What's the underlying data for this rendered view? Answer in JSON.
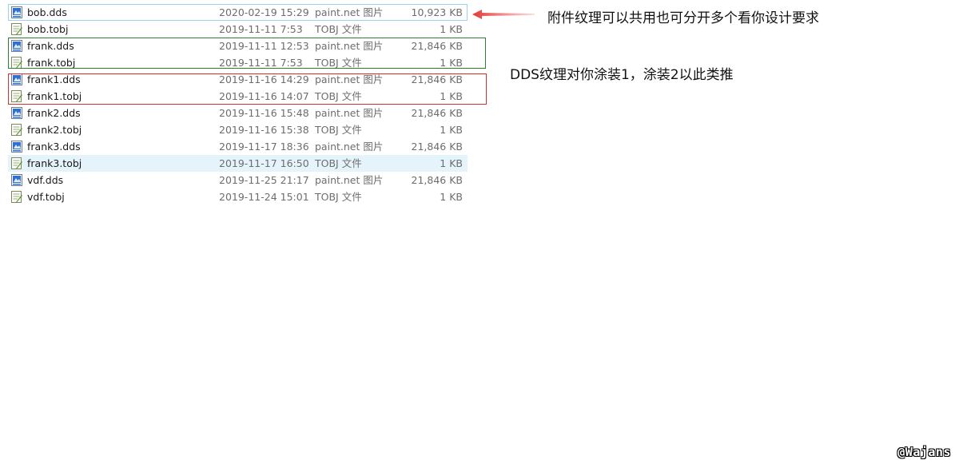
{
  "files": [
    {
      "name": "bob.dds",
      "date": "2020-02-19 15:29",
      "type": "paint.net 图片",
      "size": "10,923 KB",
      "icon": "dds-image-icon"
    },
    {
      "name": "bob.tobj",
      "date": "2019-11-11 7:53",
      "type": "TOBJ 文件",
      "size": "1 KB",
      "icon": "tobj-file-icon"
    },
    {
      "name": "frank.dds",
      "date": "2019-11-11 12:53",
      "type": "paint.net 图片",
      "size": "21,846 KB",
      "icon": "dds-image-icon"
    },
    {
      "name": "frank.tobj",
      "date": "2019-11-11 7:53",
      "type": "TOBJ 文件",
      "size": "1 KB",
      "icon": "tobj-file-icon"
    },
    {
      "name": "frank1.dds",
      "date": "2019-11-16 14:29",
      "type": "paint.net 图片",
      "size": "21,846 KB",
      "icon": "dds-image-icon"
    },
    {
      "name": "frank1.tobj",
      "date": "2019-11-16 14:07",
      "type": "TOBJ 文件",
      "size": "1 KB",
      "icon": "tobj-file-icon"
    },
    {
      "name": "frank2.dds",
      "date": "2019-11-16 15:48",
      "type": "paint.net 图片",
      "size": "21,846 KB",
      "icon": "dds-image-icon"
    },
    {
      "name": "frank2.tobj",
      "date": "2019-11-16 15:38",
      "type": "TOBJ 文件",
      "size": "1 KB",
      "icon": "tobj-file-icon"
    },
    {
      "name": "frank3.dds",
      "date": "2019-11-17 18:36",
      "type": "paint.net 图片",
      "size": "21,846 KB",
      "icon": "dds-image-icon"
    },
    {
      "name": "frank3.tobj",
      "date": "2019-11-17 16:50",
      "type": "TOBJ 文件",
      "size": "1 KB",
      "icon": "tobj-file-icon"
    },
    {
      "name": "vdf.dds",
      "date": "2019-11-25 21:17",
      "type": "paint.net 图片",
      "size": "21,846 KB",
      "icon": "dds-image-icon"
    },
    {
      "name": "vdf.tobj",
      "date": "2019-11-24 15:01",
      "type": "TOBJ 文件",
      "size": "1 KB",
      "icon": "tobj-file-icon"
    }
  ],
  "annotations": {
    "note1": "附件纹理可以共用也可分开多个看你设计要求",
    "note2": "DDS纹理对你涂装1，涂装2以此类推"
  },
  "watermark": "@Wajans",
  "colors": {
    "selected_border": "#99d1ee",
    "hover_background": "#e5f3fb",
    "green_box": "#2e7d32",
    "red_box": "#d32f2f",
    "arrow": "#e53935"
  }
}
